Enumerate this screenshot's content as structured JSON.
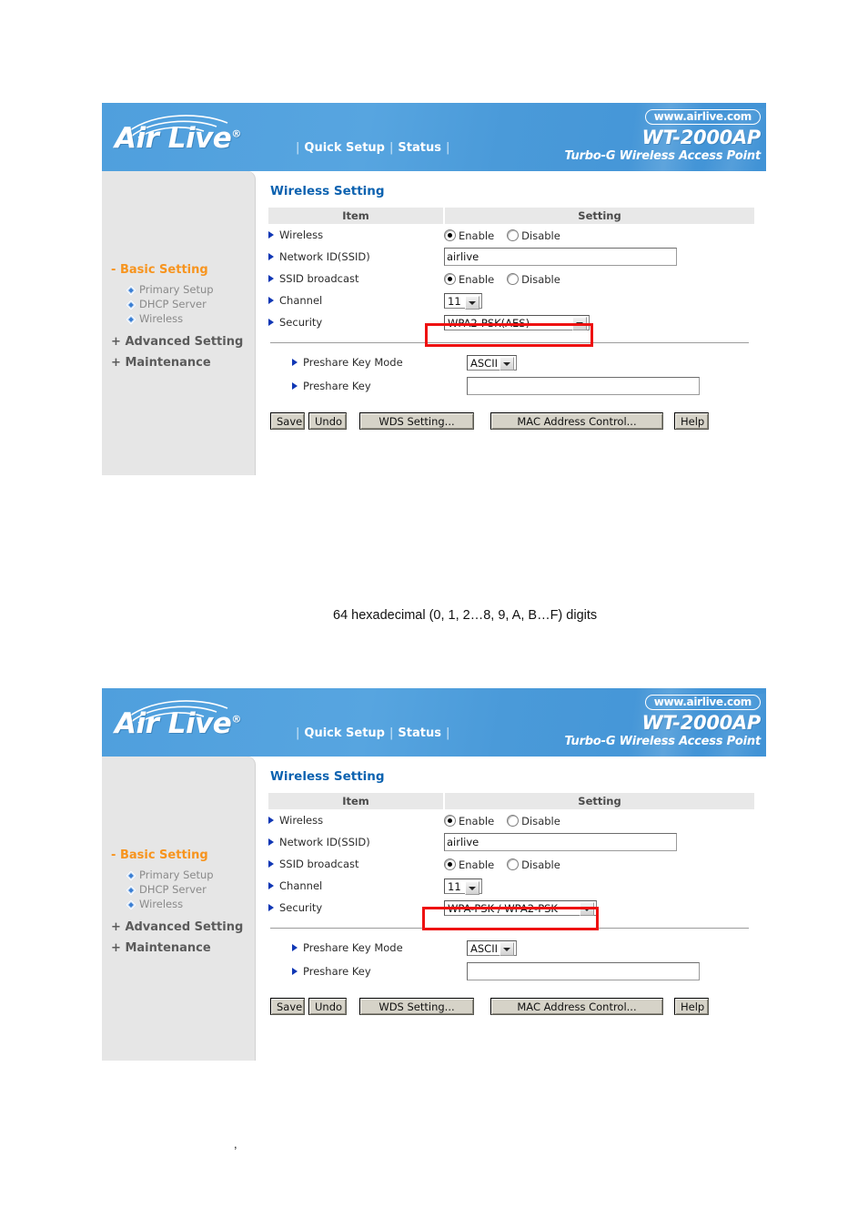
{
  "panels": [
    {
      "banner": {
        "logo_text": "Air Live",
        "logo_reg": "®",
        "nav": [
          "Quick Setup",
          "Status"
        ],
        "url_badge": "www.airlive.com",
        "model": "WT-2000AP",
        "model_sub": "Turbo-G Wireless Access Point"
      },
      "sidebar": {
        "groups": [
          {
            "prefix": "-",
            "label": "Basic Setting",
            "state": "open"
          },
          {
            "prefix": "+",
            "label": "Advanced Setting",
            "state": "closed"
          },
          {
            "prefix": "+",
            "label": "Maintenance",
            "state": "closed"
          }
        ],
        "items": [
          {
            "label": "Primary Setup"
          },
          {
            "label": "DHCP Server"
          },
          {
            "label": "Wireless"
          }
        ]
      },
      "content": {
        "title": "Wireless Setting",
        "columns": {
          "item": "Item",
          "setting": "Setting"
        },
        "rows": [
          {
            "label": "Wireless",
            "type": "radio",
            "options": [
              "Enable",
              "Disable"
            ],
            "selected": "Enable"
          },
          {
            "label": "Network ID(SSID)",
            "type": "text",
            "value": "airlive"
          },
          {
            "label": "SSID broadcast",
            "type": "radio",
            "options": [
              "Enable",
              "Disable"
            ],
            "selected": "Enable"
          },
          {
            "label": "Channel",
            "type": "select",
            "value": "11"
          },
          {
            "label": "Security",
            "type": "select",
            "value": "WPA2-PSK(AES)",
            "highlighted": true
          }
        ],
        "key_rows": [
          {
            "label": "Preshare Key Mode",
            "type": "select",
            "value": "ASCII"
          },
          {
            "label": "Preshare Key",
            "type": "text",
            "value": ""
          }
        ],
        "buttons": [
          "Save",
          "Undo",
          "WDS Setting...",
          "MAC Address Control...",
          "Help"
        ]
      }
    },
    {
      "banner": {
        "logo_text": "Air Live",
        "logo_reg": "®",
        "nav": [
          "Quick Setup",
          "Status"
        ],
        "url_badge": "www.airlive.com",
        "model": "WT-2000AP",
        "model_sub": "Turbo-G Wireless Access Point"
      },
      "sidebar": {
        "groups": [
          {
            "prefix": "-",
            "label": "Basic Setting",
            "state": "open"
          },
          {
            "prefix": "+",
            "label": "Advanced Setting",
            "state": "closed"
          },
          {
            "prefix": "+",
            "label": "Maintenance",
            "state": "closed"
          }
        ],
        "items": [
          {
            "label": "Primary Setup"
          },
          {
            "label": "DHCP Server"
          },
          {
            "label": "Wireless"
          }
        ]
      },
      "content": {
        "title": "Wireless Setting",
        "columns": {
          "item": "Item",
          "setting": "Setting"
        },
        "rows": [
          {
            "label": "Wireless",
            "type": "radio",
            "options": [
              "Enable",
              "Disable"
            ],
            "selected": "Enable"
          },
          {
            "label": "Network ID(SSID)",
            "type": "text",
            "value": "airlive"
          },
          {
            "label": "SSID broadcast",
            "type": "radio",
            "options": [
              "Enable",
              "Disable"
            ],
            "selected": "Enable"
          },
          {
            "label": "Channel",
            "type": "select",
            "value": "11"
          },
          {
            "label": "Security",
            "type": "select",
            "value": "WPA-PSK / WPA2-PSK",
            "highlighted": true
          }
        ],
        "key_rows": [
          {
            "label": "Preshare Key Mode",
            "type": "select",
            "value": "ASCII"
          },
          {
            "label": "Preshare Key",
            "type": "text",
            "value": ""
          }
        ],
        "buttons": [
          "Save",
          "Undo",
          "WDS Setting...",
          "MAC Address Control...",
          "Help"
        ]
      }
    }
  ],
  "caption": "64 hexadecimal (0, 1, 2…8, 9, A, B…F) digits",
  "stray_mark": ",",
  "colors": {
    "banner_blue": "#4f9fdd",
    "title_blue": "#0c62b0",
    "sidebar_open": "#f7941e",
    "highlight_red": "#ee1111",
    "bullet_blue": "#1037b5"
  }
}
